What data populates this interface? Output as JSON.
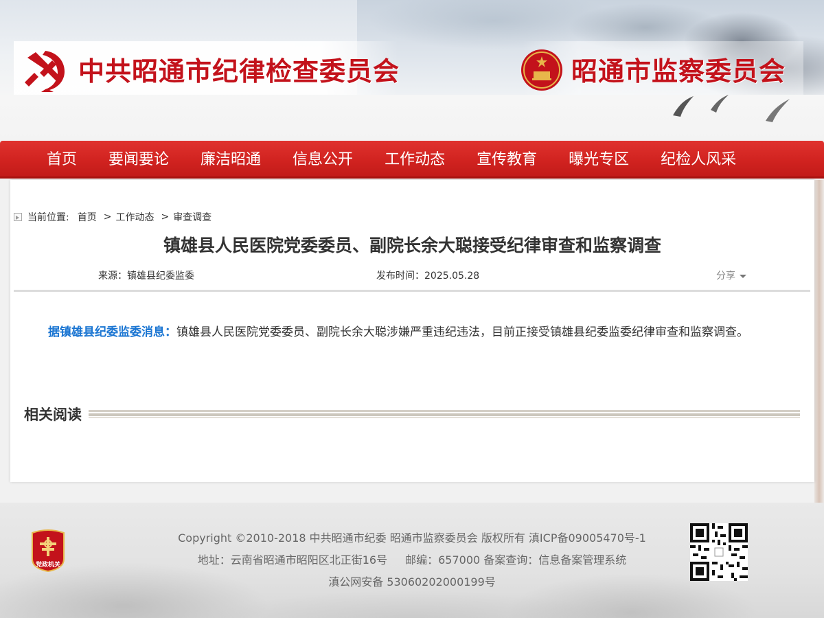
{
  "header": {
    "party_title": "中共昭通市纪律检查委员会",
    "supervision_title": "昭通市监察委员会"
  },
  "nav": {
    "items": [
      "首页",
      "要闻要论",
      "廉洁昭通",
      "信息公开",
      "工作动态",
      "宣传教育",
      "曝光专区",
      "纪检人风采"
    ]
  },
  "breadcrumb": {
    "label": "当前位置:",
    "items": [
      "首页",
      "工作动态",
      "审查调查"
    ],
    "separator": ">"
  },
  "article": {
    "title": "镇雄县人民医院党委委员、副院长余大聪接受纪律审查和监察调查",
    "source": "来源：镇雄县纪委监委",
    "publish_date": "发布时间：2025.05.28",
    "share_label": "分享",
    "lead": "据镇雄县纪委监委消息：",
    "body": "镇雄县人民医院党委委员、副院长余大聪涉嫌严重违纪违法，目前正接受镇雄县纪委监委纪律审查和监察调查。"
  },
  "related": {
    "title": "相关阅读"
  },
  "footer": {
    "copyright": "Copyright ©2010-2018 中共昭通市纪委 昭通市监察委员会 版权所有 滇ICP备09005470号-1",
    "address": "地址：云南省昭通市昭阳区北正街16号",
    "postcode": "邮编：657000 备案查询：信息备案管理系统",
    "police_record": "滇公网安备 53060202000199号",
    "logo_text": "党政机关"
  },
  "colors": {
    "brand_red": "#c3121b",
    "nav_red": "#d12320",
    "lead_blue": "#1a75d2"
  },
  "icons": [
    "party-emblem-icon",
    "national-emblem-icon",
    "breadcrumb-arrow-icon",
    "caret-down-icon",
    "government-logo-icon",
    "qr-code-icon"
  ]
}
